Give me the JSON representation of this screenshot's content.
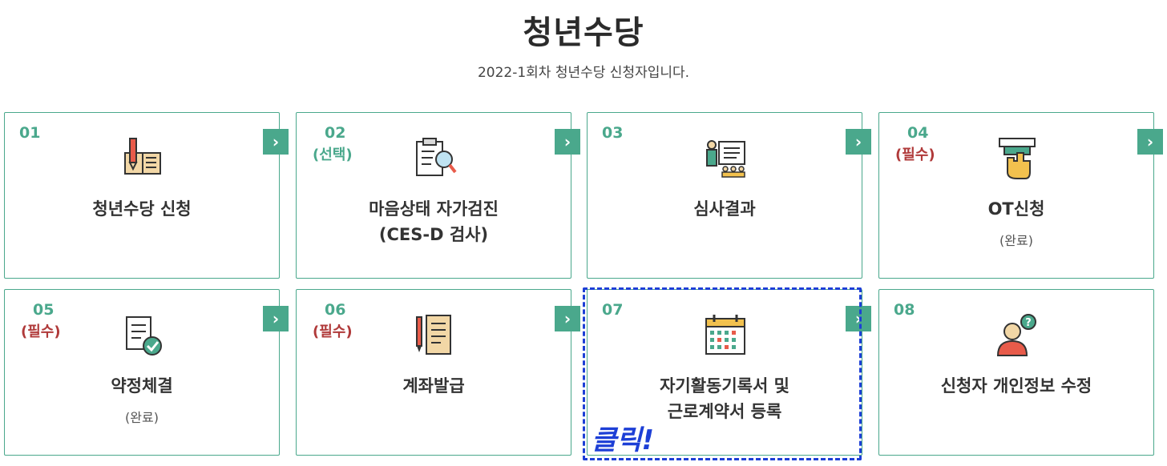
{
  "header": {
    "title": "청년수당",
    "subtitle": "2022-1회차 청년수당 신청자입니다."
  },
  "cards": [
    {
      "num": "01",
      "tag": "",
      "label_1": "청년수당 신청",
      "label_2": "",
      "sub": "",
      "icon": "book-pencil-icon"
    },
    {
      "num": "02",
      "tag": "(선택)",
      "label_1": "마음상태 자가검진",
      "label_2": "(CES-D 검사)",
      "sub": "",
      "icon": "checklist-magnifier-icon"
    },
    {
      "num": "03",
      "tag": "",
      "label_1": "심사결과",
      "label_2": "",
      "sub": "",
      "icon": "presentation-board-icon"
    },
    {
      "num": "04",
      "tag": "(필수)",
      "label_1": "OT신청",
      "label_2": "",
      "sub": "(완료)",
      "icon": "hand-card-icon"
    },
    {
      "num": "05",
      "tag": "(필수)",
      "label_1": "약정체결",
      "label_2": "",
      "sub": "(완료)",
      "icon": "document-check-icon"
    },
    {
      "num": "06",
      "tag": "(필수)",
      "label_1": "계좌발급",
      "label_2": "",
      "sub": "",
      "icon": "pen-receipt-icon"
    },
    {
      "num": "07",
      "tag": "",
      "label_1": "자기활동기록서 및",
      "label_2": "근로계약서 등록",
      "sub": "",
      "icon": "calendar-icon"
    },
    {
      "num": "08",
      "tag": "",
      "label_1": "신청자 개인정보 수정",
      "label_2": "",
      "sub": "",
      "icon": "user-question-icon"
    }
  ],
  "annotation": {
    "click_text": "클릭!"
  },
  "colors": {
    "accent": "#4aa88c",
    "required": "#b03a3a",
    "highlight": "#1d3fd6"
  }
}
